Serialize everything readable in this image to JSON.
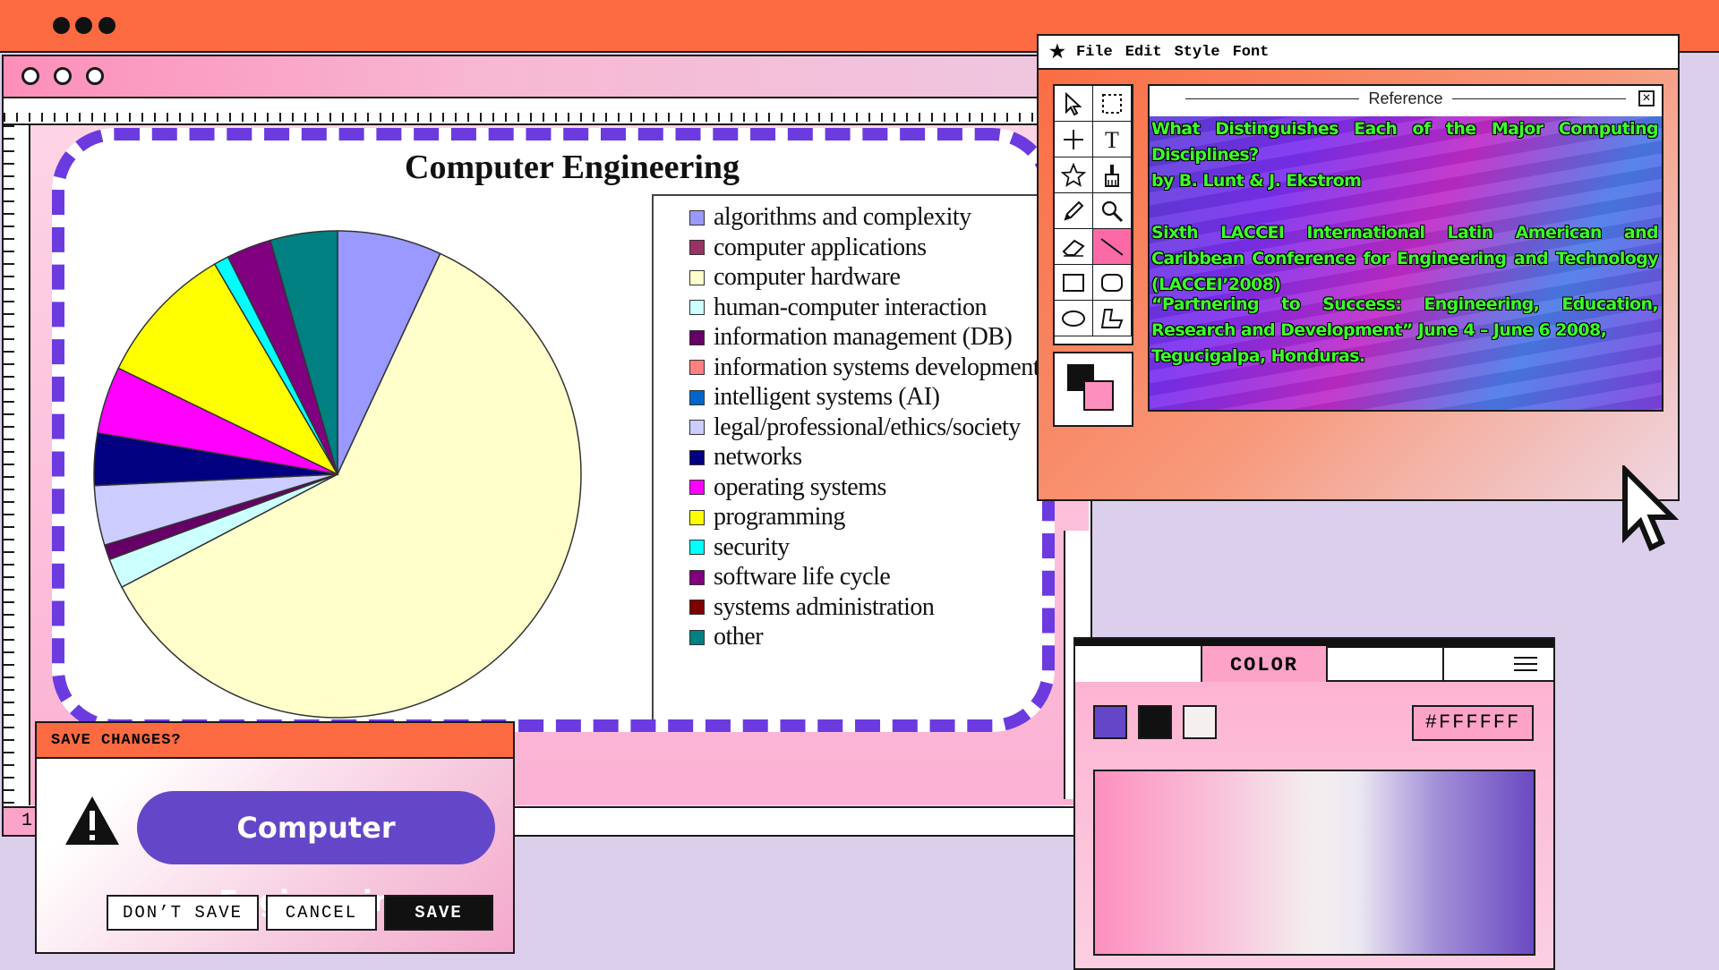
{
  "top_bar": {
    "dots": 3
  },
  "main_window": {
    "status_page": "1"
  },
  "chart_data": {
    "type": "pie",
    "title": "Computer Engineering",
    "categories": [
      "algorithms and complexity",
      "computer applications",
      "computer hardware",
      "human-computer interaction",
      "information management (DB)",
      "information systems development",
      "intelligent systems (AI)",
      "legal/professional/ethics/society",
      "networks",
      "operating systems",
      "programming",
      "security",
      "software life cycle",
      "systems administration",
      "other"
    ],
    "values": [
      7,
      0,
      61,
      2,
      1,
      0,
      0,
      4,
      3.5,
      4.5,
      9.5,
      1,
      3,
      0,
      4.5
    ],
    "colors": [
      "#9999ff",
      "#993366",
      "#ffffcc",
      "#ccffff",
      "#660066",
      "#ff8080",
      "#0066cc",
      "#ccccff",
      "#000080",
      "#ff00ff",
      "#ffff00",
      "#00ffff",
      "#800080",
      "#800000",
      "#008080"
    ],
    "legend_placement": "right"
  },
  "tool_window": {
    "menu": [
      "File",
      "Edit",
      "Style",
      "Font"
    ],
    "tools": [
      "arrow-select-icon",
      "marquee-select-icon",
      "crosshair-icon",
      "text-icon",
      "star-icon",
      "brush-icon",
      "pencil-icon",
      "magnifier-icon",
      "eraser-icon",
      "line-icon",
      "rectangle-icon",
      "rounded-rectangle-icon",
      "ellipse-icon",
      "polygon-icon"
    ],
    "reference": {
      "title": "Reference",
      "lines": [
        "What Distinguishes Each of the Major Computing Disciplines?",
        "by B. Lunt & J. Ekstrom",
        "Sixth LACCEI International Latin American and Caribbean Conference for Engineering and Technology (LACCEI’2008)",
        "“Partnering to Success: Engineering, Education, Research and Development” June 4 – June 6 2008,",
        "Tegucigalpa, Honduras."
      ]
    },
    "fg_color": "#111111",
    "bg_color": "#fd8fbe"
  },
  "save_dialog": {
    "title": "SAVE CHANGES?",
    "message": "Computer Engineering",
    "buttons": {
      "dont_save": "DON’T SAVE",
      "cancel": "CANCEL",
      "save": "SAVE"
    }
  },
  "color_panel": {
    "tab_label": "COLOR",
    "swatches": [
      "#6447c8",
      "#111111",
      "#f5f0f0"
    ],
    "hex_value": "#FFFFFF"
  }
}
